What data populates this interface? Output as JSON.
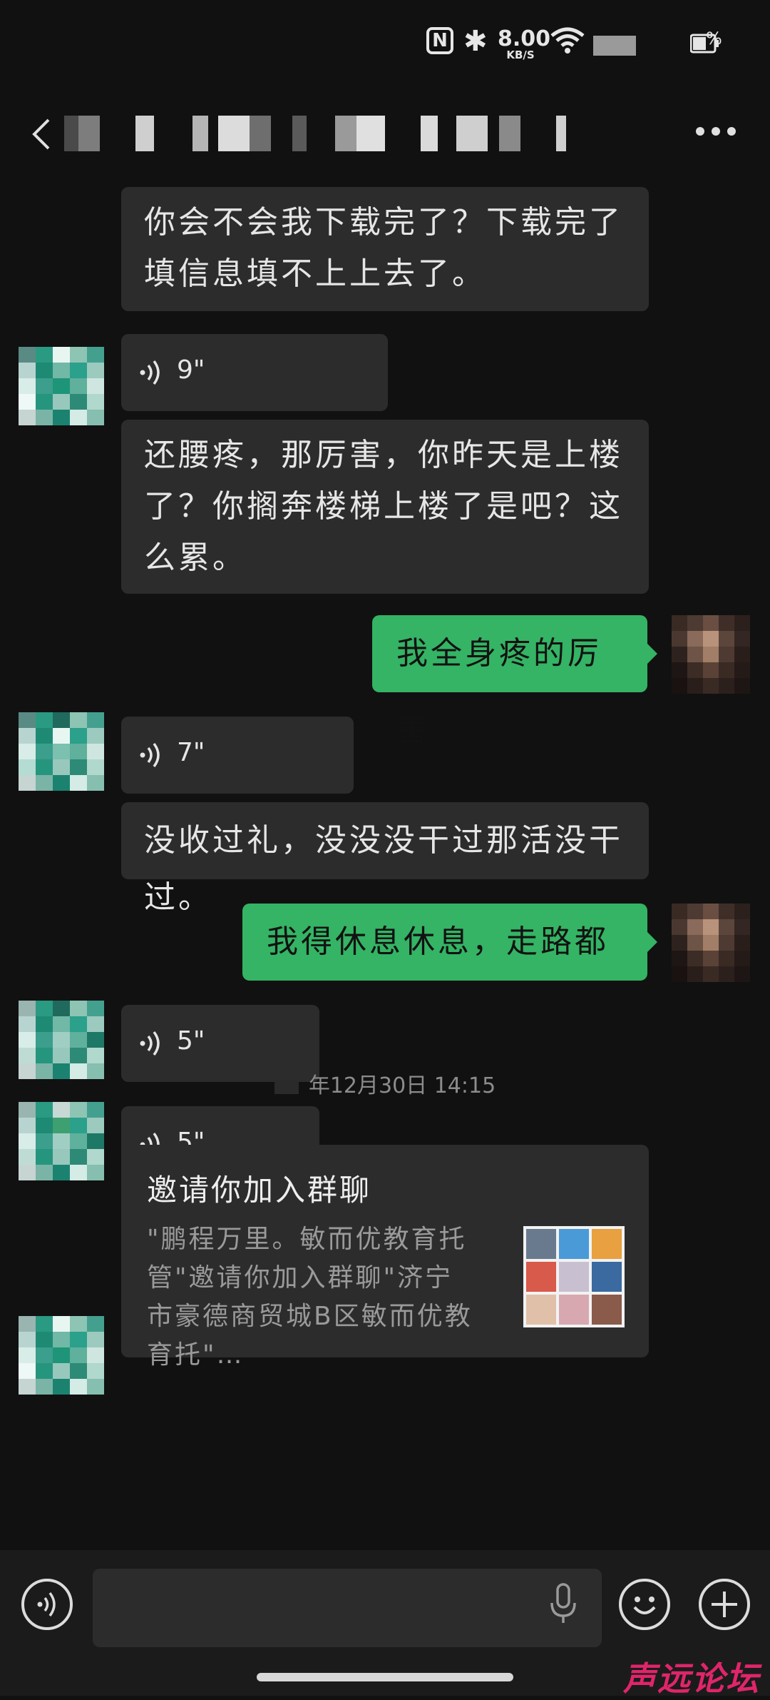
{
  "status_bar": {
    "nfc_label": "N",
    "net_speed": "8.00",
    "net_unit": "KB/S",
    "battery_pct": "%"
  },
  "header": {
    "title": "",
    "back_icon": "chevron-left",
    "more_icon": "more-horizontal"
  },
  "messages": [
    {
      "type": "text",
      "side": "in",
      "text": "你会不会我下载完了？下载完了填信息填不上上去了。"
    },
    {
      "type": "voice",
      "side": "in",
      "duration": "9\""
    },
    {
      "type": "text",
      "side": "in",
      "text": "还腰疼，那厉害，你昨天是上楼了？你搁奔楼梯上楼了是吧？这么累。"
    },
    {
      "type": "text",
      "side": "out",
      "text": "我全身疼的厉害"
    },
    {
      "type": "voice",
      "side": "in",
      "duration": "7\""
    },
    {
      "type": "text",
      "side": "in",
      "text": "没收过礼，没没没干过那活没干过。"
    },
    {
      "type": "text",
      "side": "out",
      "text": "我得休息休息，走路都疼"
    },
    {
      "type": "voice",
      "side": "in",
      "duration": "5\""
    },
    {
      "type": "voice",
      "side": "in",
      "duration": "5\""
    }
  ],
  "timestamp": "年12月30日 14:15",
  "invite_card": {
    "title": "邀请你加入群聊",
    "desc": "\"鹏程万里。敏而优教育托管\"邀请你加入群聊\"济宁市豪德商贸城B区敏而优教育托\"…"
  },
  "input_bar": {
    "voice_icon": "voice-wave",
    "mic_icon": "microphone",
    "emoji_icon": "smile",
    "plus_icon": "plus"
  },
  "watermark": "声远论坛",
  "colors": {
    "background": "#111111",
    "bubble_in": "#2c2c2c",
    "bubble_out": "#34b464",
    "watermark": "#e0256a"
  }
}
